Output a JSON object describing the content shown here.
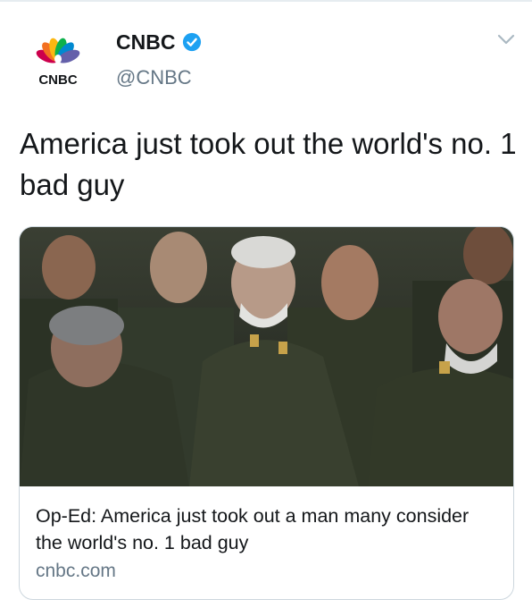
{
  "tweet": {
    "author": {
      "display_name": "CNBC",
      "handle": "@CNBC",
      "verified": true,
      "avatar_logo_text": "CNBC"
    },
    "text": "America just took out the world's no. 1 bad guy",
    "menu_icon": "chevron-down-icon"
  },
  "card": {
    "image_icon": "news-photo",
    "title": "Op-Ed: America just took out a man many consider the world's no. 1 bad guy",
    "domain": "cnbc.com"
  },
  "colors": {
    "text_primary": "#14171a",
    "text_secondary": "#657786",
    "verified_blue": "#1da1f2",
    "card_border": "#ccd6dd",
    "peacock_yellow": "#fcb711",
    "peacock_orange": "#f37021",
    "peacock_red": "#cc004c",
    "peacock_purple": "#6460aa",
    "peacock_blue": "#0089d0",
    "peacock_green": "#0db14b"
  }
}
